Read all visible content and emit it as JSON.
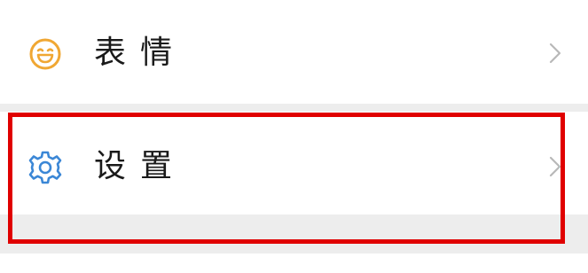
{
  "menu": {
    "items": [
      {
        "label": "表情",
        "icon": "smile-icon",
        "icon_color": "#f0a733"
      },
      {
        "label": "设置",
        "icon": "gear-icon",
        "icon_color": "#3b87d6"
      }
    ]
  },
  "colors": {
    "highlight": "#e00000",
    "chevron": "#b8b8b8",
    "background": "#ededed"
  }
}
